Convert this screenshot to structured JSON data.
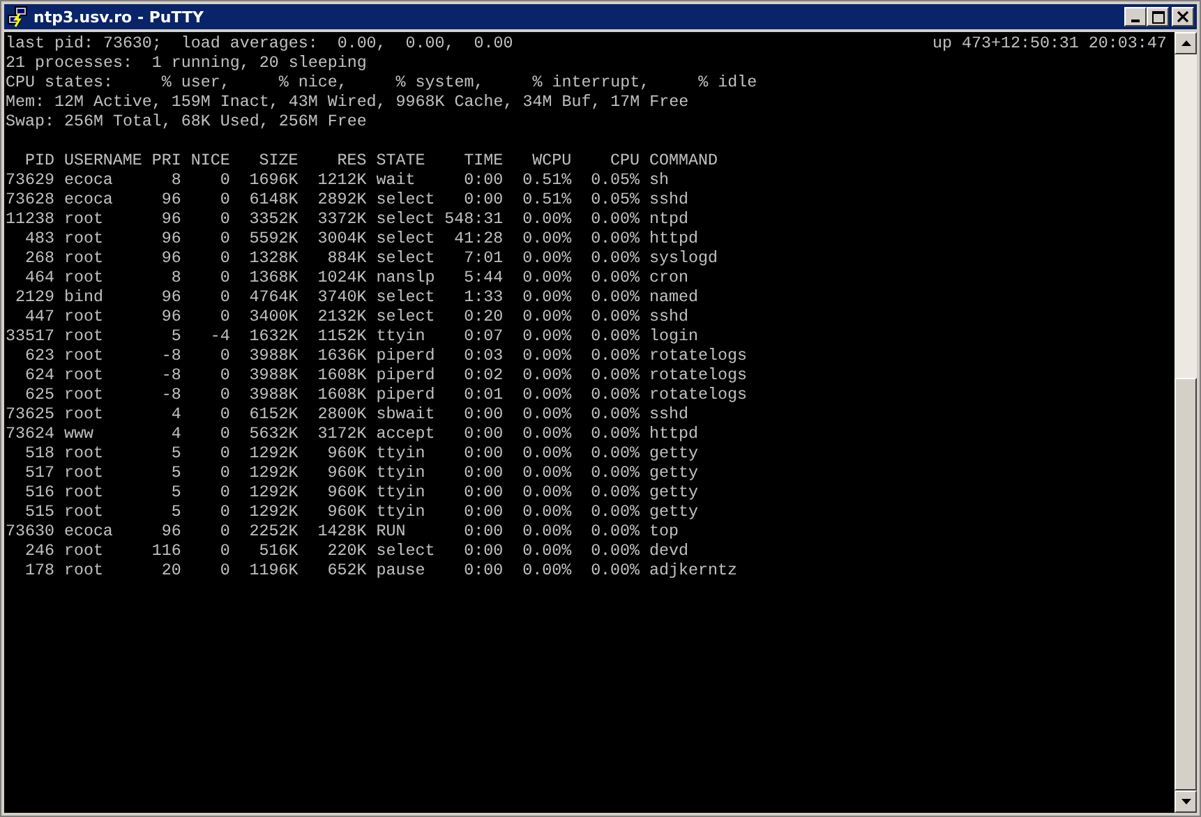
{
  "window": {
    "title": "ntp3.usv.ro - PuTTY"
  },
  "terminal": {
    "summary": [
      "last pid: 73630;  load averages:  0.00,  0.00,  0.00",
      "21 processes:  1 running, 20 sleeping",
      "CPU states:     % user,     % nice,     % system,     % interrupt,     % idle",
      "Mem: 12M Active, 159M Inact, 43M Wired, 9968K Cache, 34M Buf, 17M Free",
      "Swap: 256M Total, 68K Used, 256M Free"
    ],
    "uptime": "up 473+12:50:31 20:03:47",
    "table": {
      "columns": [
        "PID",
        "USERNAME",
        "PRI",
        "NICE",
        "SIZE",
        "RES",
        "STATE",
        "TIME",
        "WCPU",
        "CPU",
        "COMMAND"
      ],
      "rows": [
        [
          "73629",
          "ecoca",
          "8",
          "0",
          "1696K",
          "1212K",
          "wait",
          "0:00",
          "0.51%",
          "0.05%",
          "sh"
        ],
        [
          "73628",
          "ecoca",
          "96",
          "0",
          "6148K",
          "2892K",
          "select",
          "0:00",
          "0.51%",
          "0.05%",
          "sshd"
        ],
        [
          "11238",
          "root",
          "96",
          "0",
          "3352K",
          "3372K",
          "select",
          "548:31",
          "0.00%",
          "0.00%",
          "ntpd"
        ],
        [
          "483",
          "root",
          "96",
          "0",
          "5592K",
          "3004K",
          "select",
          "41:28",
          "0.00%",
          "0.00%",
          "httpd"
        ],
        [
          "268",
          "root",
          "96",
          "0",
          "1328K",
          "884K",
          "select",
          "7:01",
          "0.00%",
          "0.00%",
          "syslogd"
        ],
        [
          "464",
          "root",
          "8",
          "0",
          "1368K",
          "1024K",
          "nanslp",
          "5:44",
          "0.00%",
          "0.00%",
          "cron"
        ],
        [
          "2129",
          "bind",
          "96",
          "0",
          "4764K",
          "3740K",
          "select",
          "1:33",
          "0.00%",
          "0.00%",
          "named"
        ],
        [
          "447",
          "root",
          "96",
          "0",
          "3400K",
          "2132K",
          "select",
          "0:20",
          "0.00%",
          "0.00%",
          "sshd"
        ],
        [
          "33517",
          "root",
          "5",
          "-4",
          "1632K",
          "1152K",
          "ttyin",
          "0:07",
          "0.00%",
          "0.00%",
          "login"
        ],
        [
          "623",
          "root",
          "-8",
          "0",
          "3988K",
          "1636K",
          "piperd",
          "0:03",
          "0.00%",
          "0.00%",
          "rotatelogs"
        ],
        [
          "624",
          "root",
          "-8",
          "0",
          "3988K",
          "1608K",
          "piperd",
          "0:02",
          "0.00%",
          "0.00%",
          "rotatelogs"
        ],
        [
          "625",
          "root",
          "-8",
          "0",
          "3988K",
          "1608K",
          "piperd",
          "0:01",
          "0.00%",
          "0.00%",
          "rotatelogs"
        ],
        [
          "73625",
          "root",
          "4",
          "0",
          "6152K",
          "2800K",
          "sbwait",
          "0:00",
          "0.00%",
          "0.00%",
          "sshd"
        ],
        [
          "73624",
          "www",
          "4",
          "0",
          "5632K",
          "3172K",
          "accept",
          "0:00",
          "0.00%",
          "0.00%",
          "httpd"
        ],
        [
          "518",
          "root",
          "5",
          "0",
          "1292K",
          "960K",
          "ttyin",
          "0:00",
          "0.00%",
          "0.00%",
          "getty"
        ],
        [
          "517",
          "root",
          "5",
          "0",
          "1292K",
          "960K",
          "ttyin",
          "0:00",
          "0.00%",
          "0.00%",
          "getty"
        ],
        [
          "516",
          "root",
          "5",
          "0",
          "1292K",
          "960K",
          "ttyin",
          "0:00",
          "0.00%",
          "0.00%",
          "getty"
        ],
        [
          "515",
          "root",
          "5",
          "0",
          "1292K",
          "960K",
          "ttyin",
          "0:00",
          "0.00%",
          "0.00%",
          "getty"
        ],
        [
          "73630",
          "ecoca",
          "96",
          "0",
          "2252K",
          "1428K",
          "RUN",
          "0:00",
          "0.00%",
          "0.00%",
          "top"
        ],
        [
          "246",
          "root",
          "116",
          "0",
          "516K",
          "220K",
          "select",
          "0:00",
          "0.00%",
          "0.00%",
          "devd"
        ],
        [
          "178",
          "root",
          "20",
          "0",
          "1196K",
          "652K",
          "pause",
          "0:00",
          "0.00%",
          "0.00%",
          "adjkerntz"
        ]
      ]
    }
  }
}
